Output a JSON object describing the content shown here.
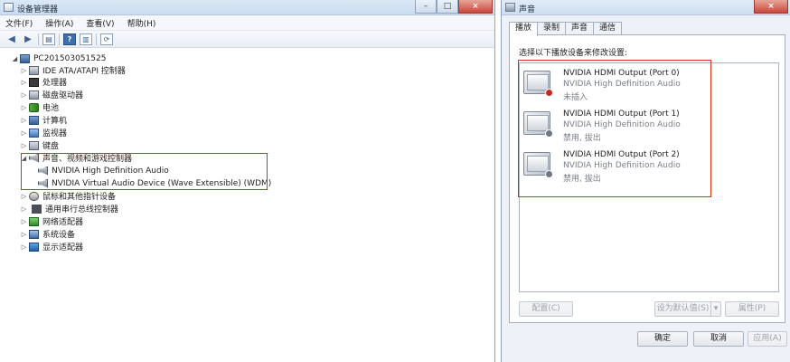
{
  "dm": {
    "title": "设备管理器",
    "menu": [
      "文件(F)",
      "操作(A)",
      "查看(V)",
      "帮助(H)"
    ],
    "root": "PC201503051525",
    "nodes": [
      {
        "label": "IDE ATA/ATAPI 控制器",
        "icon": "ide-controller-icon"
      },
      {
        "label": "处理器",
        "icon": "processor-icon"
      },
      {
        "label": "磁盘驱动器",
        "icon": "disk-drive-icon"
      },
      {
        "label": "电池",
        "icon": "battery-icon"
      },
      {
        "label": "计算机",
        "icon": "computer-icon"
      },
      {
        "label": "监视器",
        "icon": "monitor-icon"
      },
      {
        "label": "键盘",
        "icon": "keyboard-icon"
      },
      {
        "label": "声音、视频和游戏控制器",
        "icon": "speaker-icon",
        "expanded": true,
        "children": [
          "NVIDIA High Definition Audio",
          "NVIDIA Virtual Audio Device (Wave Extensible) (WDM)"
        ]
      },
      {
        "label": "鼠标和其他指针设备",
        "icon": "mouse-icon"
      },
      {
        "label": "通用串行总线控制器",
        "icon": "usb-icon"
      },
      {
        "label": "网络适配器",
        "icon": "network-adapter-icon"
      },
      {
        "label": "系统设备",
        "icon": "system-device-icon"
      },
      {
        "label": "显示适配器",
        "icon": "display-adapter-icon"
      }
    ]
  },
  "sound": {
    "title": "声音",
    "tabs": [
      "播放",
      "录制",
      "声音",
      "通信"
    ],
    "instruction": "选择以下播放设备来修改设置:",
    "devices": [
      {
        "name": "NVIDIA HDMI Output (Port 0)",
        "desc": "NVIDIA High Definition Audio",
        "status": "未插入",
        "status_color": "#c8281e"
      },
      {
        "name": "NVIDIA HDMI Output (Port 1)",
        "desc": "NVIDIA High Definition Audio",
        "status": "禁用, 拔出",
        "status_color": "#6f7782"
      },
      {
        "name": "NVIDIA HDMI Output (Port 2)",
        "desc": "NVIDIA High Definition Audio",
        "status": "禁用, 拔出",
        "status_color": "#6f7782"
      }
    ],
    "buttons": {
      "configure": "配置(C)",
      "set_default": "设为默认值(S)",
      "properties": "属性(P)",
      "ok": "确定",
      "cancel": "取消",
      "apply": "应用(A)"
    }
  },
  "window_controls": {
    "minimize": "–",
    "maximize": "□",
    "close": "×"
  }
}
